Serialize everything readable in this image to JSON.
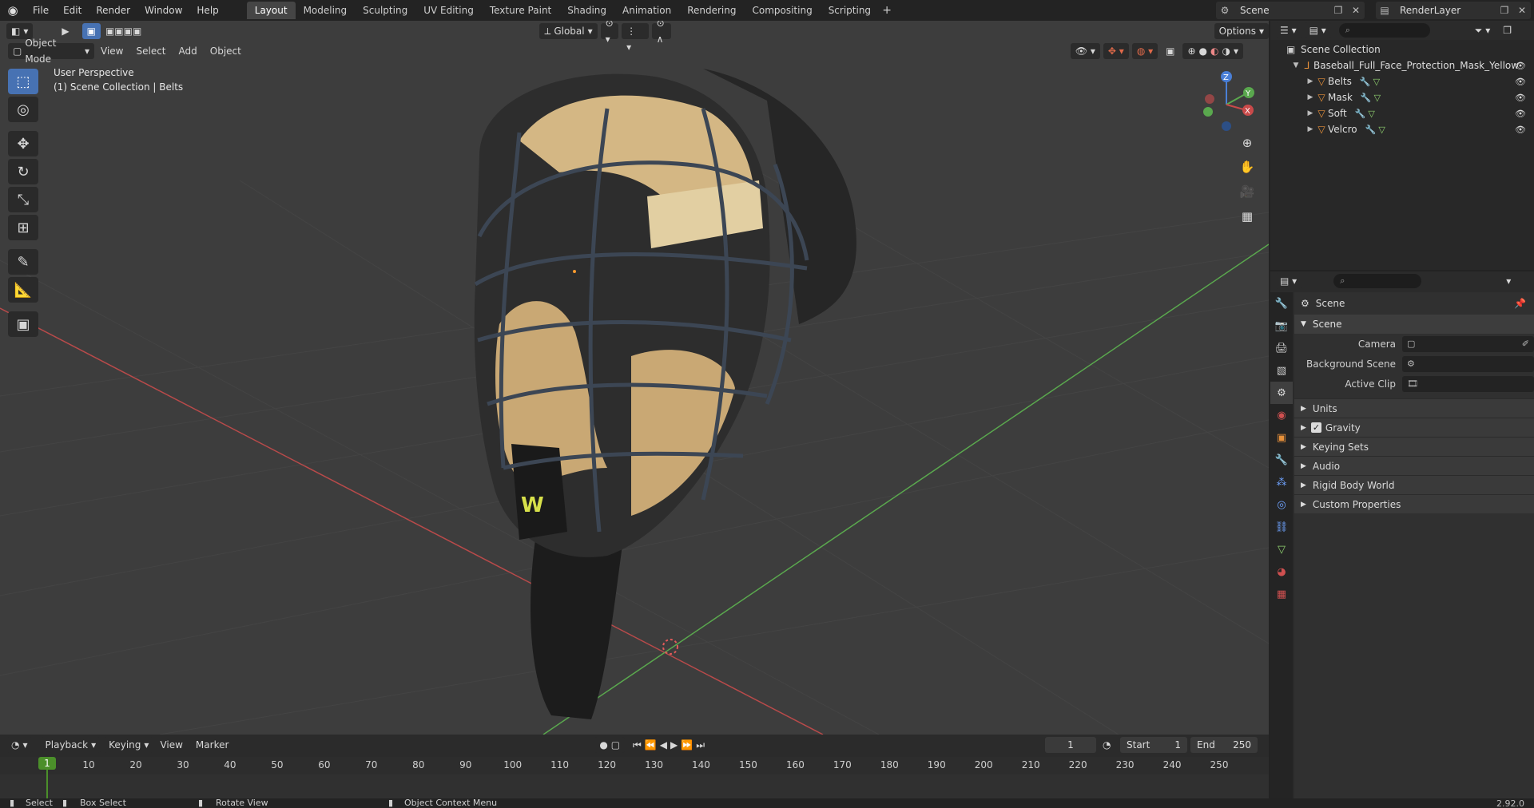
{
  "topbar": {
    "menus": [
      "File",
      "Edit",
      "Render",
      "Window",
      "Help"
    ],
    "workspaces": [
      "Layout",
      "Modeling",
      "Sculpting",
      "UV Editing",
      "Texture Paint",
      "Shading",
      "Animation",
      "Rendering",
      "Compositing",
      "Scripting"
    ],
    "active_workspace": "Layout",
    "add_label": "+",
    "scene_name": "Scene",
    "view_layer": "RenderLayer"
  },
  "viewport": {
    "mode": "Object Mode",
    "menus": [
      "View",
      "Select",
      "Add",
      "Object"
    ],
    "transform_orientation": "Global",
    "options_label": "Options",
    "overlay_title": "User Perspective",
    "overlay_subtitle": "(1) Scene Collection | Belts"
  },
  "outliner": {
    "root": "Scene Collection",
    "object": "Baseball_Full_Face_Protection_Mask_Yellow",
    "children": [
      "Belts",
      "Mask",
      "Soft",
      "Velcro"
    ]
  },
  "properties": {
    "context": "Scene",
    "panel": "Scene",
    "fields": {
      "camera": "Camera",
      "background_scene": "Background Scene",
      "active_clip": "Active Clip"
    },
    "subpanels": [
      "Units",
      "Gravity",
      "Keying Sets",
      "Audio",
      "Rigid Body World",
      "Custom Properties"
    ]
  },
  "timeline": {
    "menus": [
      "Playback",
      "Keying",
      "View",
      "Marker"
    ],
    "current_frame": "1",
    "start_label": "Start",
    "start": "1",
    "end_label": "End",
    "end": "250",
    "ticks": [
      "1",
      "10",
      "20",
      "30",
      "40",
      "50",
      "60",
      "70",
      "80",
      "90",
      "100",
      "110",
      "120",
      "130",
      "140",
      "150",
      "160",
      "170",
      "180",
      "190",
      "200",
      "210",
      "220",
      "230",
      "240",
      "250"
    ]
  },
  "statusbar": {
    "select": "Select",
    "box_select": "Box Select",
    "rotate_view": "Rotate View",
    "context_menu": "Object Context Menu",
    "version": "2.92.0"
  },
  "colors": {
    "accent": "#4772b3",
    "playhead": "#4b8f2a",
    "x_axis": "#b84a4a",
    "y_axis": "#5aa84e",
    "object_icon": "#e8913a"
  }
}
